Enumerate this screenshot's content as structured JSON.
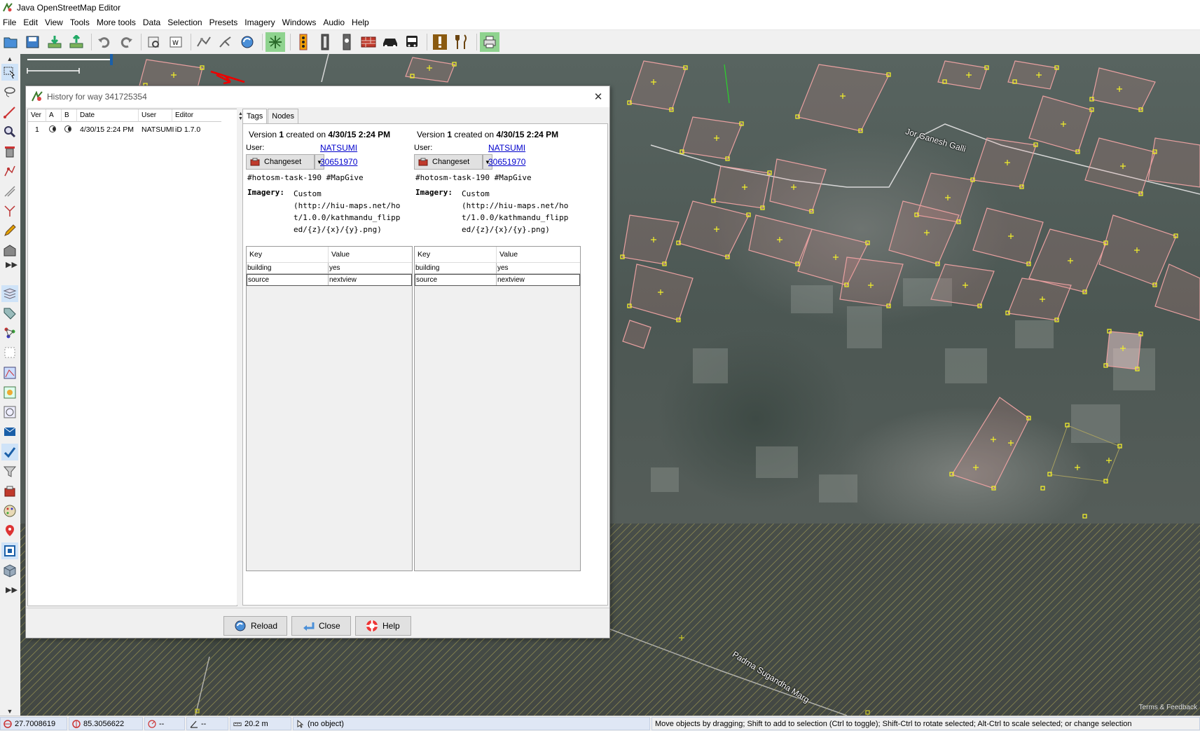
{
  "window": {
    "title": "Java OpenStreetMap Editor"
  },
  "menu": [
    "File",
    "Edit",
    "View",
    "Tools",
    "More tools",
    "Data",
    "Selection",
    "Presets",
    "Imagery",
    "Windows",
    "Audio",
    "Help"
  ],
  "toolbar": {
    "icons": [
      "open-file-icon",
      "save-icon",
      "download-icon",
      "upload-icon",
      "undo-icon",
      "redo-icon",
      "preferences-icon",
      "zoom-window-icon",
      "wireframe-icon",
      "split-way-icon",
      "combine-way-icon",
      "update-data-icon",
      "move-nodes-icon",
      "traffic-light-icon",
      "traffic-sign-icon",
      "street-lamp-icon",
      "wall-icon",
      "car-icon",
      "bus-icon",
      "amenity-icon",
      "restaurant-icon",
      "print-icon"
    ]
  },
  "map": {
    "street_labels": [
      "Jor Ganesh Galli",
      "Padma Sugandha Marg"
    ],
    "scale_text": "",
    "terms_label": "Terms & Feedback"
  },
  "dialog": {
    "title": "History for way 341725354",
    "history_table": {
      "headers": [
        "Ver",
        "A",
        "B",
        "Date",
        "User",
        "Editor"
      ],
      "rows": [
        {
          "ver": "1",
          "date": "4/30/15 2:24 PM",
          "user": "NATSUMI",
          "editor": "iD 1.7.0"
        }
      ]
    },
    "tabs": [
      "Tags",
      "Nodes"
    ],
    "versions": [
      {
        "header_prefix": "Version ",
        "version_number": "1",
        "header_middle": " created on ",
        "date": "4/30/15 2:24 PM",
        "user_label": "User:",
        "user": "NATSUMI",
        "changeset_button": "Changeset",
        "changeset_id": "30651970",
        "comment": "#hotosm-task-190 #MapGive",
        "imagery_label": "Imagery:",
        "imagery_value": "Custom\n(http://hiu-maps.net/ho\nt/1.0.0/kathmandu_flipp\ned/{z}/{x}/{y}.png)",
        "tag_headers": [
          "Key",
          "Value"
        ],
        "tags": [
          {
            "key": "building",
            "value": "yes"
          },
          {
            "key": "source",
            "value": "nextview"
          }
        ]
      },
      {
        "header_prefix": "Version ",
        "version_number": "1",
        "header_middle": " created on ",
        "date": "4/30/15 2:24 PM",
        "user_label": "User:",
        "user": "NATSUMI",
        "changeset_button": "Changeset",
        "changeset_id": "30651970",
        "comment": "#hotosm-task-190 #MapGive",
        "imagery_label": "Imagery:",
        "imagery_value": "Custom\n(http://hiu-maps.net/ho\nt/1.0.0/kathmandu_flipp\ned/{z}/{x}/{y}.png)",
        "tag_headers": [
          "Key",
          "Value"
        ],
        "tags": [
          {
            "key": "building",
            "value": "yes"
          },
          {
            "key": "source",
            "value": "nextview"
          }
        ]
      }
    ],
    "buttons": {
      "reload": "Reload",
      "close": "Close",
      "help": "Help"
    }
  },
  "status": {
    "lat": "27.7008619",
    "lon": "85.3056622",
    "heading": "--",
    "angle": "--",
    "distance": "20.2 m",
    "selection": "(no object)",
    "help_text": "Move objects by dragging; Shift to add to selection (Ctrl to toggle); Shift-Ctrl to rotate selected; Alt-Ctrl to scale selected; or change selection"
  },
  "colors": {
    "selection_way": "#e05a5a",
    "node": "#f2ef2b",
    "building_outline": "#e8a0a0",
    "dialog_bg": "#f0f0f0",
    "link": "#0000cc"
  }
}
